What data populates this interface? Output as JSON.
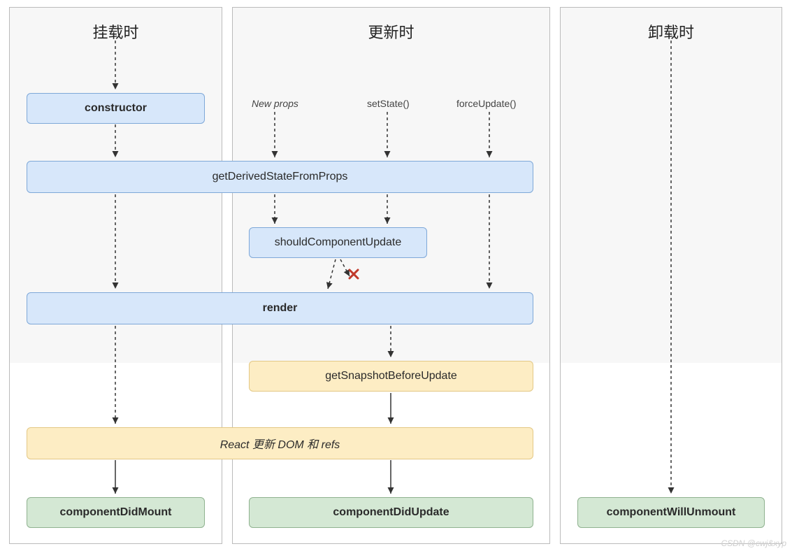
{
  "columns": {
    "mount": {
      "title": "挂载时"
    },
    "update": {
      "title": "更新时"
    },
    "unmount": {
      "title": "卸载时"
    }
  },
  "triggers": {
    "newProps": "New props",
    "setState": "setState()",
    "forceUpdate": "forceUpdate()"
  },
  "nodes": {
    "constructor": "constructor",
    "gdsfp": "getDerivedStateFromProps",
    "scu": "shouldComponentUpdate",
    "render": "render",
    "snapshot": "getSnapshotBeforeUpdate",
    "commit": "React 更新 DOM 和 refs",
    "didMount": "componentDidMount",
    "didUpdate": "componentDidUpdate",
    "willUnmount": "componentWillUnmount"
  },
  "watermark": "CSDN @cwj&xyp"
}
